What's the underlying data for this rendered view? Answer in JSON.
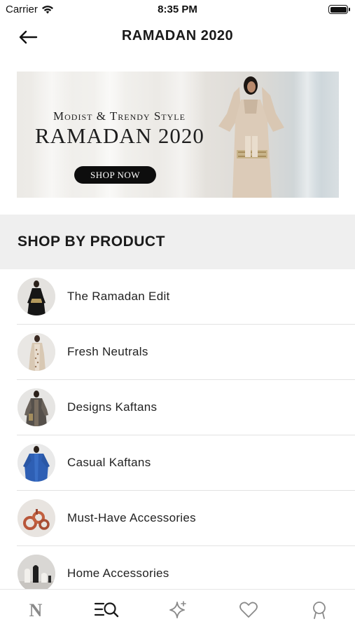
{
  "status_bar": {
    "carrier": "Carrier",
    "time": "8:35 PM"
  },
  "nav": {
    "title": "RAMADAN 2020",
    "back_icon": "arrow-left-icon"
  },
  "banner": {
    "subtitle": "Modist & Trendy Style",
    "title": "RAMADAN 2020",
    "cta": "SHOP NOW"
  },
  "section": {
    "title": "SHOP BY PRODUCT"
  },
  "products": [
    {
      "label": "The Ramadan Edit"
    },
    {
      "label": "Fresh Neutrals"
    },
    {
      "label": "Designs Kaftans"
    },
    {
      "label": "Casual Kaftans"
    },
    {
      "label": "Must-Have Accessories"
    },
    {
      "label": "Home Accessories"
    }
  ],
  "tabs": [
    {
      "icon": "brand-logo-icon",
      "label": "N"
    },
    {
      "icon": "browse-search-icon"
    },
    {
      "icon": "sparkle-icon"
    },
    {
      "icon": "heart-icon"
    },
    {
      "icon": "profile-icon"
    }
  ],
  "colors": {
    "tab_inactive": "#8a8a8a",
    "tab_active": "#1a1a1a",
    "section_bg": "#efefef",
    "button_bg": "#0d0d0d"
  }
}
